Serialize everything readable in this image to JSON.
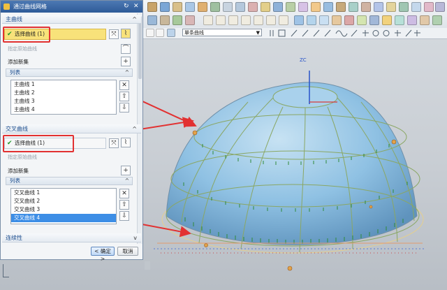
{
  "dialog": {
    "title": "通过曲线网格",
    "primary": {
      "header": "主曲线",
      "select_label": "选择曲线 (1)",
      "specify_origin": "指定原始曲线",
      "add_new_set": "添加新集",
      "list_header": "列表",
      "items": [
        "主曲线 1",
        "主曲线 2",
        "主曲线 3",
        "主曲线 4"
      ]
    },
    "cross": {
      "header": "交叉曲线",
      "select_label": "选择曲线 (1)",
      "specify_origin": "指定原始曲线",
      "add_new_set": "添加新集",
      "list_header": "列表",
      "items": [
        "交叉曲线 1",
        "交叉曲线 2",
        "交叉曲线 3",
        "交叉曲线 4"
      ],
      "selected_index": 3
    },
    "continuity_header": "连续性",
    "ok_label": "< 确定 >",
    "cancel_label": "取消"
  },
  "toolbar": {
    "filter_select_value": "單条曲线"
  },
  "viewport": {
    "axis_label": "ZC",
    "annotation_color": "#e23131",
    "surface_color": "#8fc1e3"
  }
}
